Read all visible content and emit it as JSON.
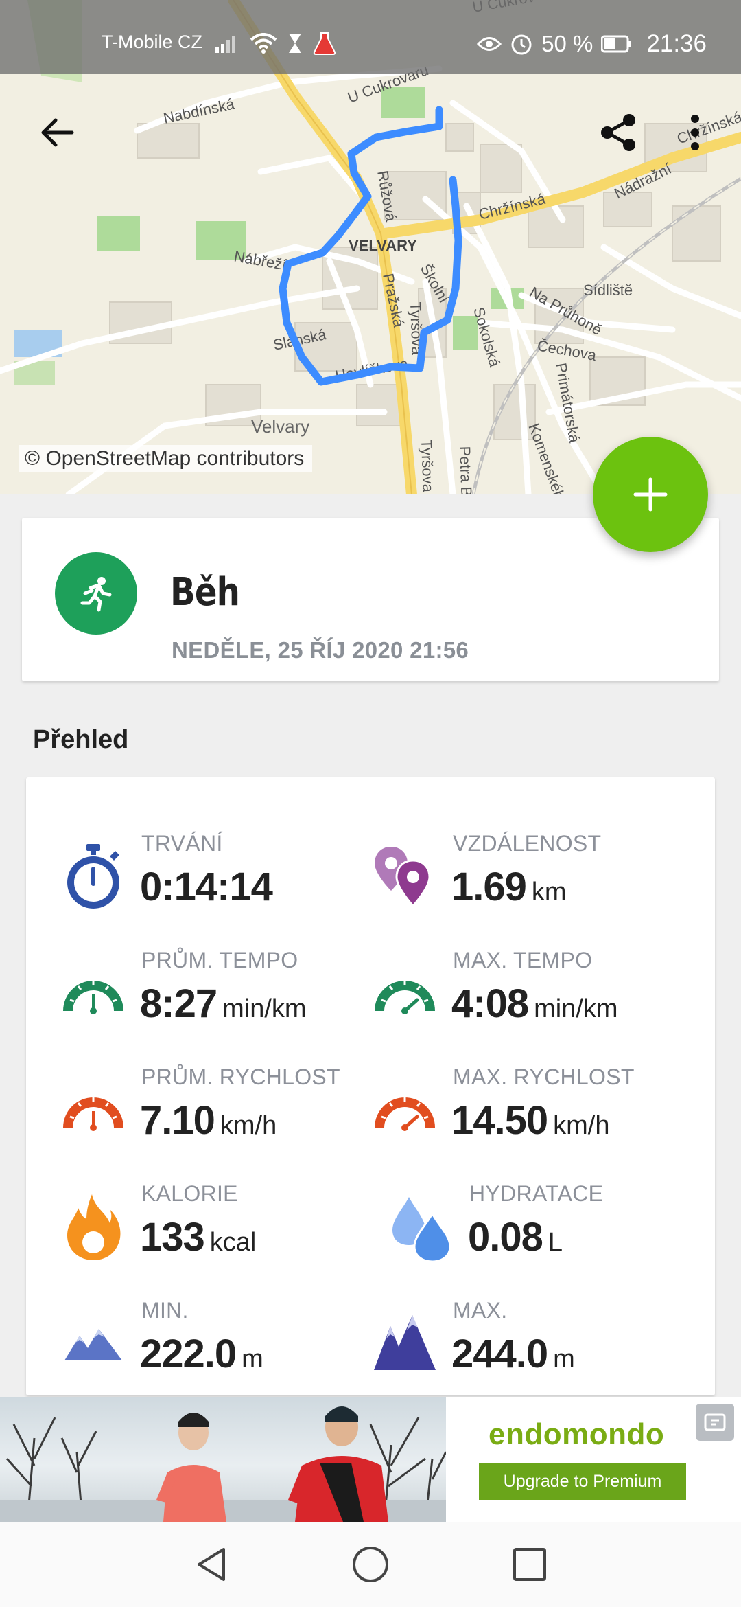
{
  "status_bar": {
    "carrier": "T-Mobile CZ",
    "battery_percent": "50 %",
    "time": "21:36"
  },
  "map": {
    "attribution": "© OpenStreetMap contributors",
    "street_labels": [
      "U Cukrovaru",
      "Nabdínská",
      "Chržínská",
      "Chržínská",
      "Nádražní",
      "VELVARY",
      "Růžová",
      "Nábřeží",
      "Pražská",
      "Školní",
      "Tyršova",
      "Sokolská",
      "Na Průhoně",
      "Sídliště",
      "Čechova",
      "Primátorská",
      "Slánská",
      "Havlíčkova",
      "Velvary",
      "Komenského",
      "Tyršova",
      "Petra Bezruče",
      "U Cukrov"
    ]
  },
  "activity": {
    "name": "Běh",
    "datetime": "NEDĚLE, 25 ŘÍJ 2020 21:56"
  },
  "overview": {
    "title": "Přehled",
    "stats": [
      {
        "label": "TRVÁNÍ",
        "value": "0:14:14",
        "unit": ""
      },
      {
        "label": "VZDÁLENOST",
        "value": "1.69",
        "unit": "km"
      },
      {
        "label": "PRŮM. TEMPO",
        "value": "8:27",
        "unit": "min/km"
      },
      {
        "label": "MAX. TEMPO",
        "value": "4:08",
        "unit": "min/km"
      },
      {
        "label": "PRŮM. RYCHLOST",
        "value": "7.10",
        "unit": "km/h"
      },
      {
        "label": "MAX. RYCHLOST",
        "value": "14.50",
        "unit": "km/h"
      },
      {
        "label": "KALORIE",
        "value": "133",
        "unit": "kcal"
      },
      {
        "label": "HYDRATACE",
        "value": "0.08",
        "unit": "L"
      },
      {
        "label": "MIN.",
        "value": "222.0",
        "unit": "m"
      },
      {
        "label": "MAX.",
        "value": "244.0",
        "unit": "m"
      }
    ]
  },
  "ad": {
    "brand": "endomondo",
    "cta": "Upgrade to Premium"
  },
  "colors": {
    "fab_green": "#6cc20f",
    "activity_green": "#1ea05a",
    "route_blue": "#3d8cff",
    "timer_blue": "#2f52a8",
    "pace_green": "#1f8a5a",
    "speed_red": "#e14d1f",
    "calorie_orange": "#f5921e",
    "water_blue": "#4f8fe8",
    "mountain_purple": "#3f3e9c",
    "pin_purple": "#8e3a8f"
  }
}
